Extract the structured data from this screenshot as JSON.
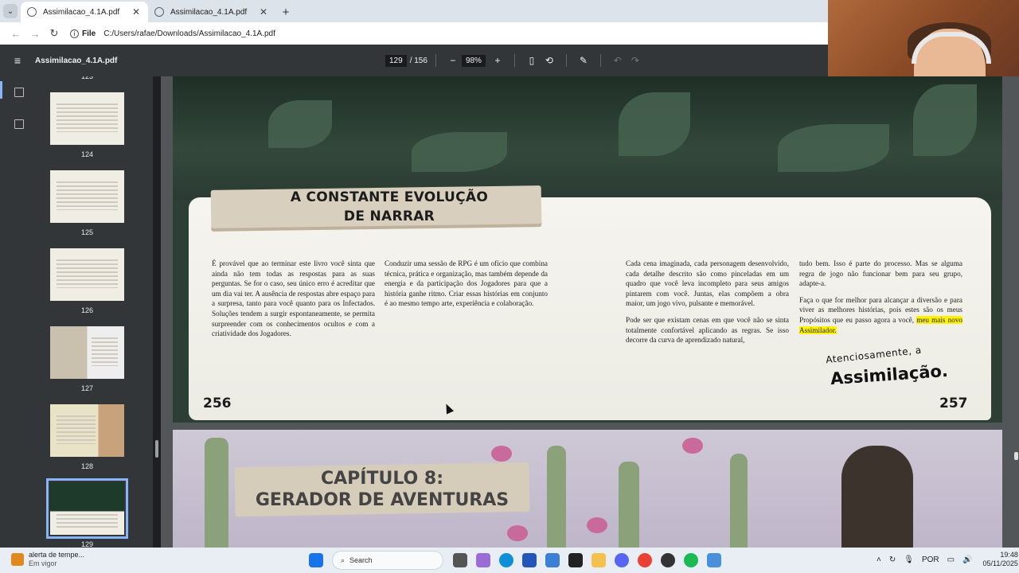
{
  "browser": {
    "tabs": [
      {
        "title": "Assimilacao_4.1A.pdf",
        "active": true
      },
      {
        "title": "Assimilacao_4.1A.pdf",
        "active": false
      }
    ],
    "address": {
      "scheme_label": "File",
      "url": "C:/Users/rafae/Downloads/Assimilacao_4.1A.pdf"
    }
  },
  "pdf": {
    "doc_name": "Assimilacao_4.1A.pdf",
    "current_page": "129",
    "total_pages": "/ 156",
    "zoom": "98%"
  },
  "thumbnails": [
    {
      "label": "123"
    },
    {
      "label": "124"
    },
    {
      "label": "125"
    },
    {
      "label": "126"
    },
    {
      "label": "127"
    },
    {
      "label": "128"
    },
    {
      "label": "129",
      "selected": true
    }
  ],
  "page_left": {
    "title_line1": "A CONSTANTE EVOLUÇÃO",
    "title_line2": "DE NARRAR",
    "col1": "É provável que ao terminar este livro você sinta que ainda não tem todas as respostas para as suas perguntas. Se for o caso, seu único erro é acreditar que um dia vai ter. A ausência de respostas abre espaço para a surpresa, tanto para você quanto para os Infectados. Soluções tendem a surgir espontaneamente, se permita surpreender com os conhecimentos ocultos e com a criatividade dos Jogadores.",
    "col2": "Conduzir uma sessão de RPG é um ofício que combina técnica, prática e organização, mas também depende da energia e da participação dos Jogadores para que a história ganhe ritmo. Criar essas histórias em conjunto é ao mesmo tempo arte, experiência e colaboração.",
    "page_number": "256"
  },
  "page_right": {
    "col3_p1": "Cada cena imaginada, cada personagem desenvolvido, cada detalhe descrito são como pinceladas em um quadro que você leva incompleto para seus amigos pintarem com você. Juntas, elas compõem a obra maior, um jogo vivo, pulsante e memorável.",
    "col3_p2": "Pode ser que existam cenas em que você não se sinta totalmente confortável aplicando as regras. Se isso decorre da curva de aprendizado natural,",
    "col4_p1": "tudo bem. Isso é parte do processo. Mas se alguma regra de jogo não funcionar bem para seu grupo, adapte-a.",
    "col4_p2_plain": "Faça o que for melhor para alcançar a diversão e para viver as melhores histórias, pois estes são os meus Propósitos que eu passo agora a você,",
    "col4_p2_highlight": "meu mais novo Assimilador.",
    "sign_line1": "Atenciosamente, a",
    "sign_line2": "Assimilação.",
    "page_number": "257"
  },
  "next_page": {
    "chapter_line1": "CAPÍTULO 8:",
    "chapter_line2": "GERADOR DE AVENTURAS"
  },
  "taskbar": {
    "alert_title": "alerta de tempe...",
    "alert_sub": "Em vigor",
    "search_placeholder": "Search",
    "lang": "POR",
    "time": "19:48",
    "date": "05/11/2025"
  }
}
